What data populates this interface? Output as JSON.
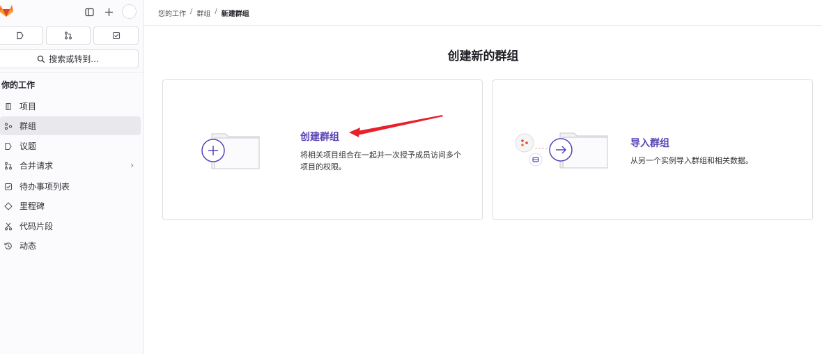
{
  "sidebar": {
    "section_title": "你的工作",
    "search_label": "搜索或转到...",
    "items": [
      {
        "label": "项目",
        "icon": "project-icon"
      },
      {
        "label": "群组",
        "icon": "group-icon",
        "active": true
      },
      {
        "label": "议题",
        "icon": "issues-icon"
      },
      {
        "label": "合并请求",
        "icon": "merge-request-icon",
        "expandable": true
      },
      {
        "label": "待办事项列表",
        "icon": "todo-icon"
      },
      {
        "label": "里程碑",
        "icon": "milestone-icon"
      },
      {
        "label": "代码片段",
        "icon": "snippet-icon"
      },
      {
        "label": "动态",
        "icon": "activity-icon"
      }
    ]
  },
  "breadcrumb": {
    "items": [
      "您的工作",
      "群组"
    ],
    "current": "新建群组",
    "separator": "/"
  },
  "page": {
    "title": "创建新的群组"
  },
  "cards": {
    "create": {
      "title": "创建群组",
      "desc_line1": "将相关项目组合在一起并一次授予成员访问多个",
      "desc_line2": "项目的权限。"
    },
    "import": {
      "title": "导入群组",
      "desc": "从另一个实例导入群组和相关数据。"
    }
  },
  "colors": {
    "accent": "#5943b6",
    "annotation_arrow": "#e8202a",
    "active_item": "#e9e8ed"
  }
}
